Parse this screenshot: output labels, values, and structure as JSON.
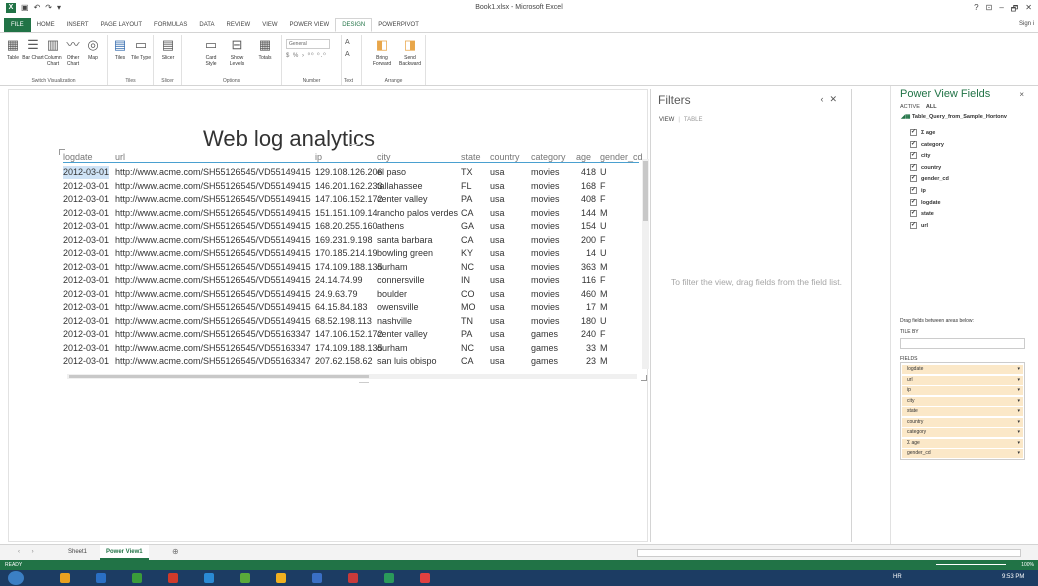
{
  "window": {
    "title": "Book1.xlsx - Microsoft Excel",
    "controls": [
      "?",
      "⊡",
      "–",
      "🗗",
      "✕"
    ],
    "sign_in": "Sign i"
  },
  "ribbon": {
    "tabs": [
      "FILE",
      "HOME",
      "INSERT",
      "PAGE LAYOUT",
      "FORMULAS",
      "DATA",
      "REVIEW",
      "VIEW",
      "POWER VIEW",
      "DESIGN",
      "POWERPIVOT"
    ],
    "active_tab": "DESIGN",
    "groups": {
      "switch_visualization": {
        "name": "Switch Visualization",
        "buttons": [
          "Table",
          "Bar Chart",
          "Column Chart",
          "Other Chart",
          "Map"
        ]
      },
      "tiles": {
        "name": "Tiles",
        "buttons": [
          "Tiles",
          "Tile Type"
        ]
      },
      "slicer": {
        "name": "Slicer",
        "buttons": [
          "Slicer"
        ]
      },
      "options": {
        "name": "Options",
        "buttons": [
          "Card Style",
          "Show Levels",
          "Totals"
        ]
      },
      "number": {
        "name": "Number",
        "format_value": "General",
        "symbols": "$ % › ⁰⁰ ⁰.⁰"
      },
      "text": {
        "name": "Text"
      },
      "arrange": {
        "name": "Arrange",
        "buttons": [
          "Bring Forward",
          "Send Backward"
        ]
      }
    }
  },
  "canvas": {
    "report_title": "Web log analytics",
    "table": {
      "columns": [
        "logdate",
        "url",
        "ip",
        "city",
        "state",
        "country",
        "category",
        "age",
        "gender_cd"
      ],
      "rows": [
        [
          "2012-03-01",
          "http://www.acme.com/SH55126545/VD55149415",
          "129.108.126.206",
          "el paso",
          "TX",
          "usa",
          "movies",
          "418",
          "U"
        ],
        [
          "2012-03-01",
          "http://www.acme.com/SH55126545/VD55149415",
          "146.201.162.233",
          "tallahassee",
          "FL",
          "usa",
          "movies",
          "168",
          "F"
        ],
        [
          "2012-03-01",
          "http://www.acme.com/SH55126545/VD55149415",
          "147.106.152.172",
          "center valley",
          "PA",
          "usa",
          "movies",
          "408",
          "F"
        ],
        [
          "2012-03-01",
          "http://www.acme.com/SH55126545/VD55149415",
          "151.151.109.14",
          "rancho palos verdes",
          "CA",
          "usa",
          "movies",
          "144",
          "M"
        ],
        [
          "2012-03-01",
          "http://www.acme.com/SH55126545/VD55149415",
          "168.20.255.160",
          "athens",
          "GA",
          "usa",
          "movies",
          "154",
          "U"
        ],
        [
          "2012-03-01",
          "http://www.acme.com/SH55126545/VD55149415",
          "169.231.9.198",
          "santa barbara",
          "CA",
          "usa",
          "movies",
          "200",
          "F"
        ],
        [
          "2012-03-01",
          "http://www.acme.com/SH55126545/VD55149415",
          "170.185.214.19",
          "bowling green",
          "KY",
          "usa",
          "movies",
          "14",
          "U"
        ],
        [
          "2012-03-01",
          "http://www.acme.com/SH55126545/VD55149415",
          "174.109.188.135",
          "durham",
          "NC",
          "usa",
          "movies",
          "363",
          "M"
        ],
        [
          "2012-03-01",
          "http://www.acme.com/SH55126545/VD55149415",
          "24.14.74.99",
          "connersville",
          "IN",
          "usa",
          "movies",
          "116",
          "F"
        ],
        [
          "2012-03-01",
          "http://www.acme.com/SH55126545/VD55149415",
          "24.9.63.79",
          "boulder",
          "CO",
          "usa",
          "movies",
          "460",
          "M"
        ],
        [
          "2012-03-01",
          "http://www.acme.com/SH55126545/VD55149415",
          "64.15.84.183",
          "owensville",
          "MO",
          "usa",
          "movies",
          "17",
          "M"
        ],
        [
          "2012-03-01",
          "http://www.acme.com/SH55126545/VD55149415",
          "68.52.198.113",
          "nashville",
          "TN",
          "usa",
          "movies",
          "180",
          "U"
        ],
        [
          "2012-03-01",
          "http://www.acme.com/SH55126545/VD55163347",
          "147.106.152.172",
          "center valley",
          "PA",
          "usa",
          "games",
          "240",
          "F"
        ],
        [
          "2012-03-01",
          "http://www.acme.com/SH55126545/VD55163347",
          "174.109.188.135",
          "durham",
          "NC",
          "usa",
          "games",
          "33",
          "M"
        ],
        [
          "2012-03-01",
          "http://www.acme.com/SH55126545/VD55163347",
          "207.62.158.62",
          "san luis obispo",
          "CA",
          "usa",
          "games",
          "23",
          "M"
        ]
      ]
    }
  },
  "filters": {
    "title": "Filters",
    "collapse": "‹",
    "close": "✕",
    "tab_view": "VIEW",
    "tab_table": "TABLE",
    "hint": "To filter the view, drag fields from the field list."
  },
  "field_list": {
    "title": "Power View Fields",
    "close": "×",
    "tab_active": "ACTIVE",
    "tab_all": "ALL",
    "table_name": "Table_Query_from_Sample_Hortonv",
    "fields": [
      "Σ age",
      "category",
      "city",
      "country",
      "gender_cd",
      "ip",
      "logdate",
      "state",
      "url"
    ],
    "drag_hint": "Drag fields between areas below:",
    "tile_by_label": "TILE BY",
    "fields_label": "FIELDS",
    "wells": [
      "logdate",
      "url",
      "ip",
      "city",
      "state",
      "country",
      "category",
      "Σ age",
      "gender_cd"
    ]
  },
  "sheets": {
    "nav": "‹ ›",
    "tabs": [
      "Sheet1",
      "Power View1"
    ],
    "active": "Power View1",
    "add": "⊕"
  },
  "status": {
    "ready": "READY",
    "zoom": "100%"
  },
  "taskbar": {
    "lang": "HR",
    "clock": "9:53 PM",
    "colors": [
      "#e8a020",
      "#2a6fc4",
      "#3a9c3a",
      "#d03a2a",
      "#2a8ad4",
      "#5aaa3a",
      "#f0b020",
      "#3a6fc4",
      "#c83a3a",
      "#2a9a5a",
      "#e04040"
    ]
  }
}
